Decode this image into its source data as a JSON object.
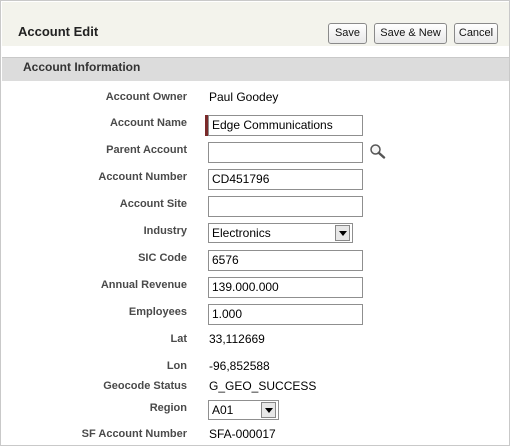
{
  "header": {
    "title": "Account Edit",
    "buttons": {
      "save": "Save",
      "save_new": "Save & New",
      "cancel": "Cancel"
    }
  },
  "section": {
    "title": "Account Information"
  },
  "fields": {
    "account_owner": {
      "label": "Account Owner",
      "value": "Paul Goodey"
    },
    "account_name": {
      "label": "Account Name",
      "value": "Edge Communications"
    },
    "parent_account": {
      "label": "Parent Account",
      "value": ""
    },
    "account_number": {
      "label": "Account Number",
      "value": "CD451796"
    },
    "account_site": {
      "label": "Account Site",
      "value": ""
    },
    "industry": {
      "label": "Industry",
      "value": "Electronics"
    },
    "sic_code": {
      "label": "SIC Code",
      "value": "6576"
    },
    "annual_revenue": {
      "label": "Annual Revenue",
      "value": "139.000.000"
    },
    "employees": {
      "label": "Employees",
      "value": "1.000"
    },
    "lat": {
      "label": "Lat",
      "value": "33,112669"
    },
    "lon": {
      "label": "Lon",
      "value": "-96,852588"
    },
    "geocode_status": {
      "label": "Geocode Status",
      "value": "G_GEO_SUCCESS"
    },
    "region": {
      "label": "Region",
      "value": "A01"
    },
    "sf_account_number": {
      "label": "SF Account Number",
      "value": "SFA-000017"
    }
  },
  "icons": {
    "lookup": "magnifier-icon",
    "dropdown": "chevron-down-icon"
  },
  "colors": {
    "required_marker": "#7a2a2a",
    "header_bg": "#f3f3ec",
    "section_bg": "#dcdcdc"
  }
}
